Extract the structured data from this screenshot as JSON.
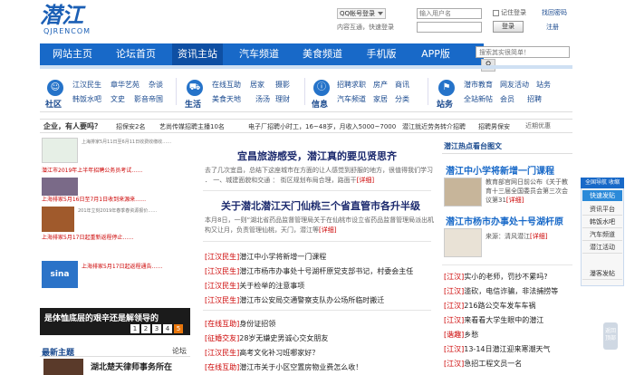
{
  "logo": {
    "text": "潜江",
    "sub": "QJRENCOM"
  },
  "login": {
    "qq_label": "QQ帐号登录",
    "qq_hint": "内容互通，快速登录",
    "username_placeholder": "输入用户名",
    "password_placeholder": "",
    "remember_label": "记住登录",
    "login_button": "登录",
    "find_password": "找回密码",
    "register": "注册"
  },
  "nav": {
    "items": [
      "网站主页",
      "论坛首页",
      "资讯主站",
      "汽车频道",
      "美食频道",
      "手机版",
      "APP版"
    ],
    "active_index": 2
  },
  "search": {
    "placeholder": "搜索其实很简单！",
    "button_icon": "search-icon"
  },
  "categories": [
    {
      "name": "社区",
      "icon": "people-icon",
      "links": [
        "江汉民生",
        "章华艺苑",
        "杂谈",
        "韩饭水吧",
        "文史",
        "影音帝国"
      ]
    },
    {
      "name": "生活",
      "icon": "car-icon",
      "links": [
        "在线互助",
        "居家",
        "摄影",
        "美食天地",
        "汤汤",
        "理财"
      ]
    },
    {
      "name": "信息",
      "icon": "info-icon",
      "links": [
        "招聘求职",
        "房产",
        "商讯",
        "汽车频道",
        "家居",
        "分类"
      ]
    },
    {
      "name": "站务",
      "icon": "station-icon",
      "links": [
        "潜市教育",
        "网友活动",
        "站务",
        "全站新帖",
        "会员",
        "招聘"
      ]
    }
  ],
  "ticker": {
    "question": "企业，有人要吗？",
    "items": [
      "招保安2名",
      "艺尚传媒招聘主播10名",
      "电子厂招聘小时工，16~48岁，月收入5000~7000",
      "潜江就近劳务转介招聘",
      "招聘男保安"
    ],
    "prev": "近期优惠"
  },
  "left": {
    "snippets": [
      "上海排家5月11日至6月11日收费收缴收……",
      "潜江市2019年上半年招聘公务员考试……",
      "上海排家5月16日至7月1日收到来源来……",
      "201年立刻2019年春季春资源报价……",
      "上海排家5月17日起重新返程停止……",
      "上海排家5月17日起返程通告……"
    ],
    "banner": "是体恤底层的艰辛还是解领导的",
    "pages": [
      "1",
      "2",
      "3",
      "4",
      "5"
    ],
    "active_page": 4,
    "latest_title": "最新主题",
    "latest_more": "论坛",
    "latest_link": "湖北楚天律师事务所在"
  },
  "middle": {
    "headline1": "宜昌旅游感受，潜江真的要见贤思齐",
    "para1": "去了几次宜昌，总结下这座城市在方面的让人感觉到舒服的地方，很值得我们学习 ． 一、城建面貌和交通 ： 街区规划布局合理，路面干",
    "more1": "[详细]",
    "headline2": "关于潜北潜江天门仙桃三个省直管市各升半级",
    "para2": "本月8日，一则“湖北省药品监督管理局关于在仙桃市设立省药品监督管理局派出机构又让月，负责管理仙桃，天门，潜江等",
    "more2": "[详细]",
    "items1": [
      {
        "tag": "[江汉民生]",
        "text": "潜江中小学将新增一门课程"
      },
      {
        "tag": "[江汉民生]",
        "text": "潜江市杨市办事处十号湖杆原党支部书记，村委会主任"
      },
      {
        "tag": "[江汉民生]",
        "text": "关于检举的注意事项"
      },
      {
        "tag": "[江汉民生]",
        "text": "潜江市公安局交通警察支队办公场所临时搬迁"
      }
    ],
    "items2": [
      {
        "tag": "[在线互助]",
        "text": "身份证招领"
      },
      {
        "tag": "[征婚交友]",
        "text": "28岁无嫌史男诚心交女朋友"
      },
      {
        "tag": "[江汉民生]",
        "text": "高考文化补习班哪家好？"
      },
      {
        "tag": "[在线互助]",
        "text": "潜江市关于小区空置房物业费怎么收！"
      }
    ]
  },
  "right": {
    "title": "潜江热点看台图文",
    "feature1": {
      "title": "潜江中小学将新增一门课程",
      "text": "教育部官网日前公布《关于教育十三届全国委员会第三次会议第31",
      "more": "[详细]"
    },
    "feature2": {
      "title": "潜江市杨市办事处十号湖杆原",
      "text": "来源：清风潜江",
      "more": "[详细]"
    },
    "items": [
      {
        "tag": "[江汉]",
        "text": "实小的老师，罚抄不累吗?"
      },
      {
        "tag": "[江汉]",
        "text": "滥砍，电信诈骗，非法捕捞等"
      },
      {
        "tag": "[江汉]",
        "text": "216路公交车发车车祸"
      },
      {
        "tag": "[江汉]",
        "text": "来看看大学生眼中的潜江"
      },
      {
        "tag": "[谐趣]",
        "text": "乡愁"
      },
      {
        "tag": "[江汉]",
        "text": "13-14日潜江迎来寒潮天气"
      },
      {
        "tag": "[江汉]",
        "text": "急招工程文员一名"
      }
    ]
  },
  "float_nav": {
    "header": "全国导航 收缩",
    "sub": "快速发贴",
    "items": [
      "资讯平台",
      "韩饭水吧",
      "汽车频道",
      "潜江活动",
      "瀑客发帖"
    ],
    "top": "返回顶部"
  }
}
